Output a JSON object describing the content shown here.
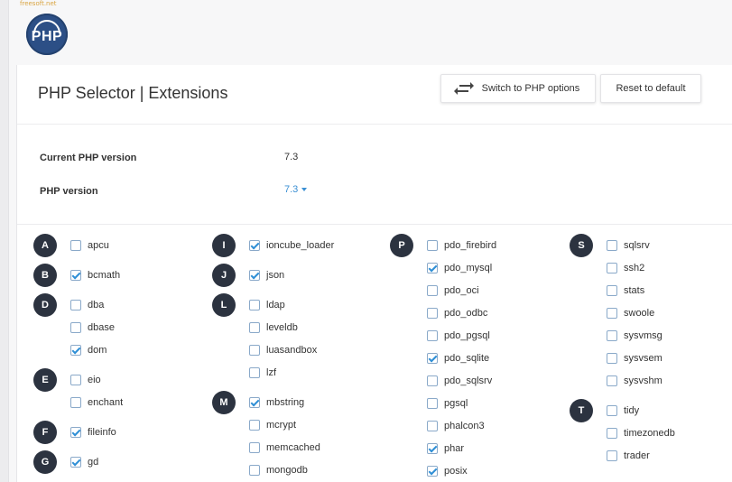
{
  "watermark": "freesoft.net",
  "logo": {
    "text": "PHP"
  },
  "header": {
    "title": "PHP Selector | Extensions",
    "switch_label": "Switch to PHP options",
    "reset_label": "Reset to default"
  },
  "info": {
    "current_label": "Current PHP version",
    "current_value": "7.3",
    "version_label": "PHP version",
    "version_value": "7.3"
  },
  "groups": [
    {
      "letter": "A",
      "items": [
        {
          "name": "apcu",
          "checked": false
        }
      ]
    },
    {
      "letter": "B",
      "items": [
        {
          "name": "bcmath",
          "checked": true
        }
      ]
    },
    {
      "letter": "D",
      "items": [
        {
          "name": "dba",
          "checked": false
        },
        {
          "name": "dbase",
          "checked": false
        },
        {
          "name": "dom",
          "checked": true
        }
      ]
    },
    {
      "letter": "E",
      "items": [
        {
          "name": "eio",
          "checked": false
        },
        {
          "name": "enchant",
          "checked": false
        }
      ]
    },
    {
      "letter": "F",
      "items": [
        {
          "name": "fileinfo",
          "checked": true
        }
      ]
    },
    {
      "letter": "G",
      "items": [
        {
          "name": "gd",
          "checked": true
        }
      ]
    },
    {
      "letter": "I",
      "items": [
        {
          "name": "ioncube_loader",
          "checked": true
        }
      ]
    },
    {
      "letter": "J",
      "items": [
        {
          "name": "json",
          "checked": true
        }
      ]
    },
    {
      "letter": "L",
      "items": [
        {
          "name": "ldap",
          "checked": false
        },
        {
          "name": "leveldb",
          "checked": false
        },
        {
          "name": "luasandbox",
          "checked": false
        },
        {
          "name": "lzf",
          "checked": false
        }
      ]
    },
    {
      "letter": "M",
      "items": [
        {
          "name": "mbstring",
          "checked": true
        },
        {
          "name": "mcrypt",
          "checked": false
        },
        {
          "name": "memcached",
          "checked": false
        },
        {
          "name": "mongodb",
          "checked": false
        }
      ]
    },
    {
      "letter": "P",
      "items": [
        {
          "name": "pdo_firebird",
          "checked": false
        },
        {
          "name": "pdo_mysql",
          "checked": true
        },
        {
          "name": "pdo_oci",
          "checked": false
        },
        {
          "name": "pdo_odbc",
          "checked": false
        },
        {
          "name": "pdo_pgsql",
          "checked": false
        },
        {
          "name": "pdo_sqlite",
          "checked": true
        },
        {
          "name": "pdo_sqlsrv",
          "checked": false
        },
        {
          "name": "pgsql",
          "checked": false
        },
        {
          "name": "phalcon3",
          "checked": false
        },
        {
          "name": "phar",
          "checked": true
        },
        {
          "name": "posix",
          "checked": true
        }
      ]
    },
    {
      "letter": "S",
      "items": [
        {
          "name": "sqlsrv",
          "checked": false
        },
        {
          "name": "ssh2",
          "checked": false
        },
        {
          "name": "stats",
          "checked": false
        },
        {
          "name": "swoole",
          "checked": false
        },
        {
          "name": "sysvmsg",
          "checked": false
        },
        {
          "name": "sysvsem",
          "checked": false
        },
        {
          "name": "sysvshm",
          "checked": false
        }
      ]
    },
    {
      "letter": "T",
      "items": [
        {
          "name": "tidy",
          "checked": false
        },
        {
          "name": "timezonedb",
          "checked": false
        },
        {
          "name": "trader",
          "checked": false
        }
      ]
    }
  ]
}
